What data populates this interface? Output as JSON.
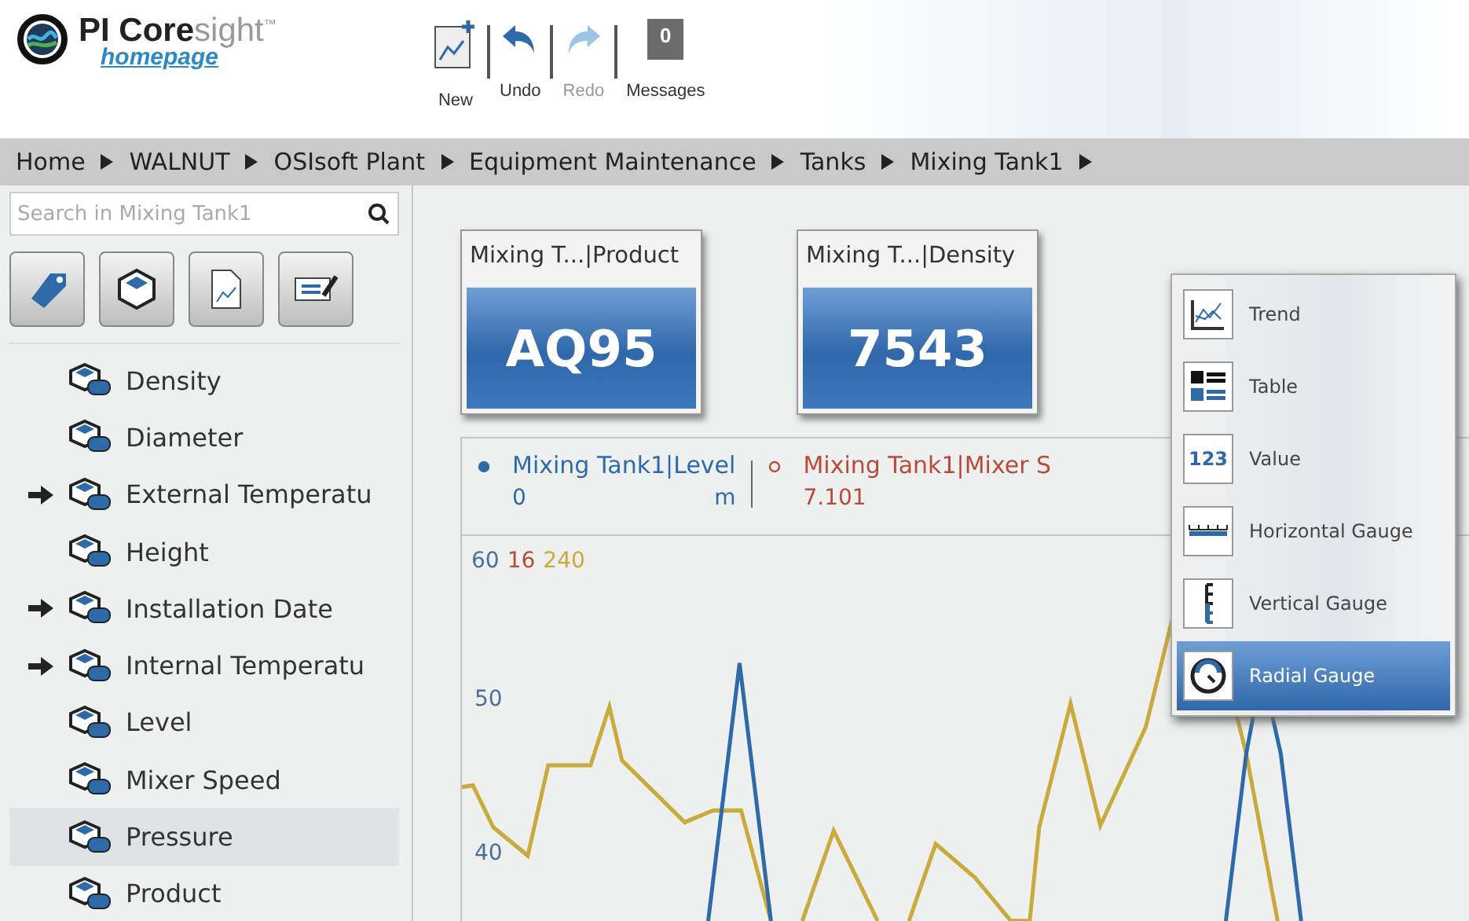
{
  "app": {
    "brand_bold": "PI Core",
    "brand_light": "sight",
    "trademark": "™",
    "subtitle": "homepage"
  },
  "toolbar": [
    {
      "kind": "new",
      "label": "New",
      "disabled": false
    },
    {
      "kind": "undo",
      "label": "Undo",
      "disabled": false
    },
    {
      "kind": "redo",
      "label": "Redo",
      "disabled": true
    },
    {
      "kind": "messages",
      "label": "Messages",
      "count": "0",
      "disabled": false
    }
  ],
  "breadcrumb": [
    "Home",
    "WALNUT",
    "OSIsoft Plant",
    "Equipment Maintenance",
    "Tanks",
    "Mixing Tank1"
  ],
  "search": {
    "placeholder": "Search in Mixing Tank1"
  },
  "tool_buttons": [
    {
      "kind": "tag"
    },
    {
      "kind": "cube"
    },
    {
      "kind": "document"
    },
    {
      "kind": "list"
    }
  ],
  "attributes": [
    {
      "label": "Density",
      "arrow": false,
      "selected": false
    },
    {
      "label": "Diameter",
      "arrow": false,
      "selected": false
    },
    {
      "label": "External Temperatu",
      "arrow": true,
      "selected": false
    },
    {
      "label": "Height",
      "arrow": false,
      "selected": false
    },
    {
      "label": "Installation Date",
      "arrow": true,
      "selected": false
    },
    {
      "label": "Internal Temperatu",
      "arrow": true,
      "selected": false
    },
    {
      "label": "Level",
      "arrow": false,
      "selected": false
    },
    {
      "label": "Mixer Speed",
      "arrow": false,
      "selected": false
    },
    {
      "label": "Pressure",
      "arrow": false,
      "selected": true
    },
    {
      "label": "Product",
      "arrow": false,
      "selected": false
    }
  ],
  "value_tiles": [
    {
      "title": "Mixing T...|Product",
      "value": "AQ95"
    },
    {
      "title": "Mixing T...|Density",
      "value": "7543"
    }
  ],
  "trend": {
    "legend": [
      {
        "kind": "filled",
        "name": "Mixing Tank1|Level",
        "value": "0",
        "unit": "m",
        "color": "#2e6aa8"
      },
      {
        "kind": "hollow",
        "name": "Mixing Tank1|Mixer S",
        "value": "7.101",
        "color": "#b84a3a"
      }
    ],
    "scale_tops": [
      {
        "label": "60",
        "color": "#4a6f9a"
      },
      {
        "label": "16",
        "color": "#b84a3a"
      },
      {
        "label": "240",
        "color": "#c9aa3c"
      }
    ],
    "ticks": [
      "50",
      "40"
    ]
  },
  "menu": [
    {
      "kind": "trend",
      "label": "Trend",
      "selected": false
    },
    {
      "kind": "table",
      "label": "Table",
      "selected": false
    },
    {
      "kind": "value",
      "label": "Value",
      "icon_text": "123",
      "selected": false
    },
    {
      "kind": "hgauge",
      "label": "Horizontal Gauge",
      "selected": false
    },
    {
      "kind": "vgauge",
      "label": "Vertical Gauge",
      "selected": false
    },
    {
      "kind": "radial",
      "label": "Radial Gauge",
      "selected": true
    }
  ]
}
